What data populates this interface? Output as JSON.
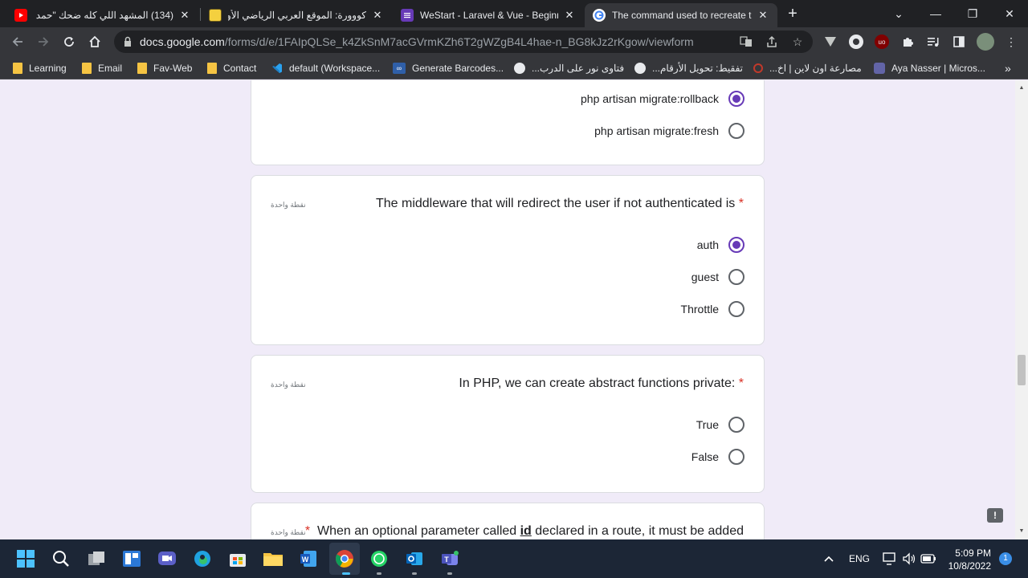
{
  "tabs": [
    {
      "title": "(134) المشهد اللي كله ضحك \"حمد",
      "active": false
    },
    {
      "title": "كووورة: الموقع العربي الرياضي الأول",
      "active": false
    },
    {
      "title": "WeStart - Laravel & Vue - Beginn",
      "active": false
    },
    {
      "title": "The command used to recreate th",
      "active": true
    }
  ],
  "toolbar": {
    "url_host": "docs.google.com",
    "url_path": "/forms/d/e/1FAIpQLSe_k4ZkSnM7acGVrmKZh6T2gWZgB4L4hae-n_BG8kJz2rKgow/viewform"
  },
  "bookmarks": [
    "Learning",
    "Email",
    "Fav-Web",
    "Contact",
    "default (Workspace...",
    "Generate Barcodes...",
    "فتاوى نور على الدرب...",
    "تفقيط: تحويل الأرقام...",
    "مصارعة اون لاين | اخ...",
    "Aya Nasser | Micros..."
  ],
  "form": {
    "q1_options": [
      {
        "label": "php artisan migrate:rollback",
        "checked": true
      },
      {
        "label": "php artisan migrate:fresh",
        "checked": false
      }
    ],
    "q2": {
      "title": "The middleware that will redirect the user if not authenticated is",
      "points": "نقطة واحدة",
      "options": [
        {
          "label": "auth",
          "checked": true
        },
        {
          "label": "guest",
          "checked": false
        },
        {
          "label": "Throttle",
          "checked": false
        }
      ]
    },
    "q3": {
      "title": ":In PHP, we can create abstract functions private",
      "points": "نقطة واحدة",
      "options": [
        {
          "label": "True",
          "checked": false
        },
        {
          "label": "False",
          "checked": false
        }
      ]
    },
    "q4": {
      "title_pre": "When an optional parameter called ",
      "title_bold": "id",
      "title_post": " declared in a route, it must be added",
      "points": "نقطة واحدة"
    },
    "required_mark": "*"
  },
  "taskbar": {
    "language": "ENG",
    "time": "5:09 PM",
    "date": "10/8/2022",
    "notifications": "1"
  },
  "colors": {
    "accent": "#673ab7",
    "page_bg": "#f0ebf8",
    "required": "#d93025"
  }
}
